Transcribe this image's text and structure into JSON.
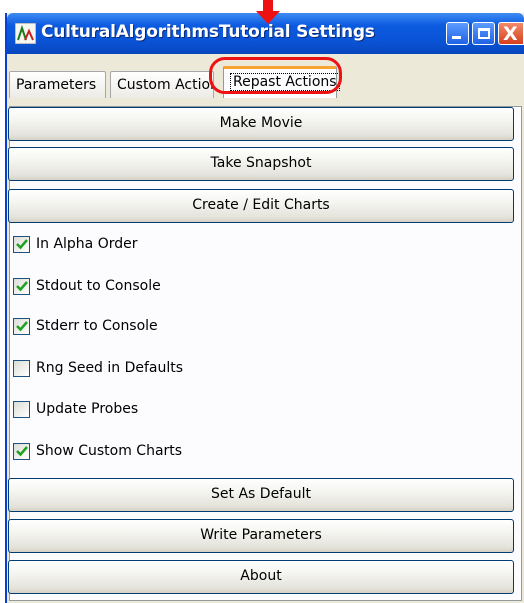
{
  "window": {
    "title": "CulturalAlgorithmsTutorial Settings",
    "close_glyph": "X"
  },
  "tabs": [
    {
      "label": "Parameters"
    },
    {
      "label": "Custom Actions"
    },
    {
      "label": "Repast Actions",
      "selected": true
    }
  ],
  "buttons": {
    "make_movie": "Make Movie",
    "take_snapshot": "Take Snapshot",
    "create_edit_charts": "Create / Edit Charts",
    "set_as_default": "Set As Default",
    "write_parameters": "Write Parameters",
    "about": "About"
  },
  "options": [
    {
      "label": "In Alpha Order",
      "checked": true
    },
    {
      "label": "Stdout to Console",
      "checked": true
    },
    {
      "label": "Stderr to Console",
      "checked": true
    },
    {
      "label": "Rng Seed in Defaults",
      "checked": false
    },
    {
      "label": "Update Probes",
      "checked": false
    },
    {
      "label": "Show Custom Charts",
      "checked": true
    }
  ],
  "colors": {
    "title_bar": "#0a53d6",
    "highlight": "#ee1111",
    "check": "#21a121"
  }
}
